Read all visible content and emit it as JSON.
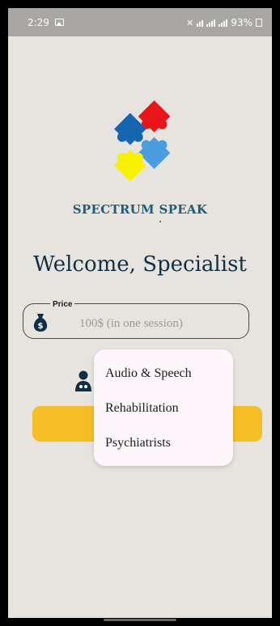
{
  "status_bar": {
    "time": "2:29",
    "battery": "93%"
  },
  "logo": {
    "colors": [
      "#e8151b",
      "#1565b0",
      "#4a9ee0",
      "#f6f200"
    ]
  },
  "brand": {
    "name": "SPECTRUM SPEAK"
  },
  "welcome": {
    "title": "Welcome, Specialist"
  },
  "price": {
    "label": "Price",
    "placeholder": "100$ (in one session)"
  },
  "specialty_dropdown": {
    "options": [
      "Audio & Speech",
      "Rehabilitation",
      "Psychiatrists"
    ]
  },
  "theme": {
    "background": "#e7e4df",
    "accent_yellow": "#f5be27",
    "navy": "#0f2f45",
    "brand_blue": "#1e5c7a"
  }
}
